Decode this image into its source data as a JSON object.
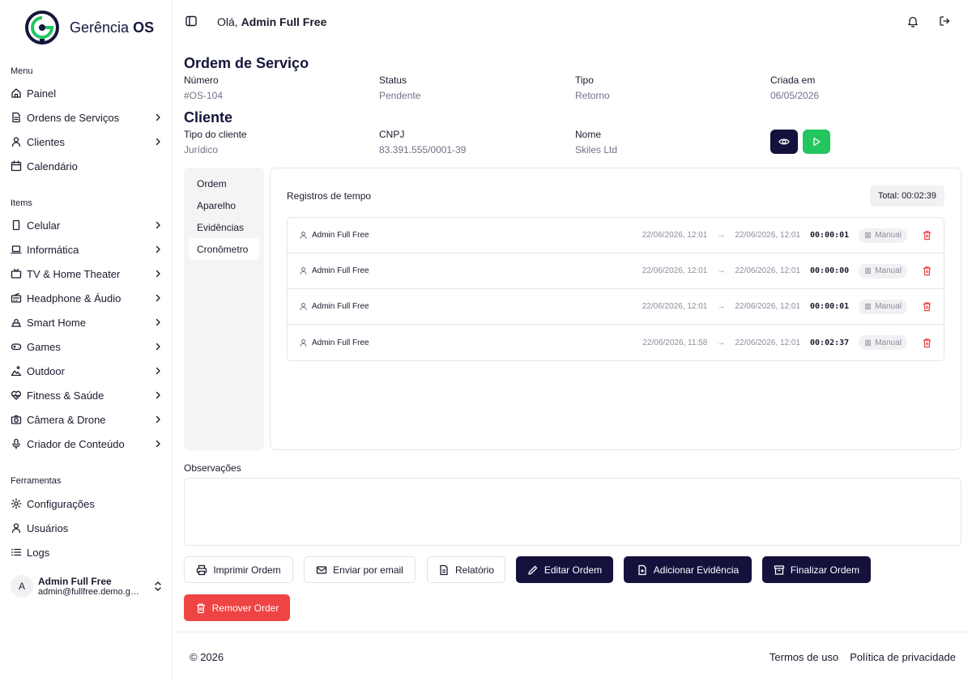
{
  "app": {
    "logo_text": "Gerência",
    "logo_bold": "OS"
  },
  "sidebar": {
    "menu_title": "Menu",
    "menu": [
      {
        "label": "Painel",
        "icon": "home-icon",
        "chevron": false
      },
      {
        "label": "Ordens de Serviços",
        "icon": "document-icon",
        "chevron": true
      },
      {
        "label": "Clientes",
        "icon": "user-icon",
        "chevron": true
      },
      {
        "label": "Calendário",
        "icon": "calendar-icon",
        "chevron": false
      }
    ],
    "items_title": "Items",
    "items": [
      {
        "label": "Celular",
        "icon": "phone-icon"
      },
      {
        "label": "Informática",
        "icon": "laptop-icon"
      },
      {
        "label": "TV & Home Theater",
        "icon": "tv-icon"
      },
      {
        "label": "Headphone & Áudio",
        "icon": "radio-icon"
      },
      {
        "label": "Smart Home",
        "icon": "smart-home-icon"
      },
      {
        "label": "Games",
        "icon": "gamepad-icon"
      },
      {
        "label": "Outdoor",
        "icon": "outdoor-icon"
      },
      {
        "label": "Fitness & Saúde",
        "icon": "heart-pulse-icon"
      },
      {
        "label": "Câmera & Drone",
        "icon": "camera-icon"
      },
      {
        "label": "Criador de Conteúdo",
        "icon": "mic-icon"
      }
    ],
    "tools_title": "Ferramentas",
    "tools": [
      {
        "label": "Configurações",
        "icon": "gear-icon"
      },
      {
        "label": "Usuários",
        "icon": "user-icon"
      },
      {
        "label": "Logs",
        "icon": "list-icon"
      }
    ],
    "user": {
      "initial": "A",
      "name": "Admin Full Free",
      "email": "admin@fullfree.demo.ger..."
    }
  },
  "header": {
    "greeting_prefix": "Olá,",
    "greeting_name": "Admin Full Free"
  },
  "order": {
    "title": "Ordem de Serviço",
    "fields": [
      {
        "label": "Número",
        "value": "#OS-104"
      },
      {
        "label": "Status",
        "value": "Pendente"
      },
      {
        "label": "Tipo",
        "value": "Retorno"
      },
      {
        "label": "Criada em",
        "value": "06/05/2026"
      }
    ]
  },
  "client": {
    "title": "Cliente",
    "fields": [
      {
        "label": "Tipo do cliente",
        "value": "Jurídico"
      },
      {
        "label": "CNPJ",
        "value": "83.391.555/0001-39"
      },
      {
        "label": "Nome",
        "value": "Skiles Ltd"
      }
    ]
  },
  "tabs": [
    "Ordem",
    "Aparelho",
    "Evidências",
    "Cronômetro"
  ],
  "active_tab": 3,
  "time_records": {
    "title": "Registros de tempo",
    "total": "Total: 00:02:39",
    "rows": [
      {
        "user": "Admin Full Free",
        "start": "22/06/2026, 12:01",
        "end": "22/06/2026, 12:01",
        "duration": "00:00:01",
        "mode": "Manual"
      },
      {
        "user": "Admin Full Free",
        "start": "22/06/2026, 12:01",
        "end": "22/06/2026, 12:01",
        "duration": "00:00:00",
        "mode": "Manual"
      },
      {
        "user": "Admin Full Free",
        "start": "22/06/2026, 12:01",
        "end": "22/06/2026, 12:01",
        "duration": "00:00:01",
        "mode": "Manual"
      },
      {
        "user": "Admin Full Free",
        "start": "22/06/2026, 11:58",
        "end": "22/06/2026, 12:01",
        "duration": "00:02:37",
        "mode": "Manual"
      }
    ]
  },
  "observations": {
    "label": "Observações"
  },
  "actions": {
    "print": "Imprimir Ordem",
    "email": "Enviar por email",
    "report": "Relatório",
    "edit": "Editar Ordem",
    "add_evidence": "Adicionar Evidência",
    "finish": "Finalizar Ordem",
    "remove": "Remover Order"
  },
  "footer": {
    "copyright": "© 2026",
    "terms": "Termos de uso",
    "privacy": "Política de privacidade"
  },
  "colors": {
    "primary_dark": "#14113d",
    "success": "#22c55e",
    "danger": "#ef4444",
    "muted": "#6f7389"
  }
}
